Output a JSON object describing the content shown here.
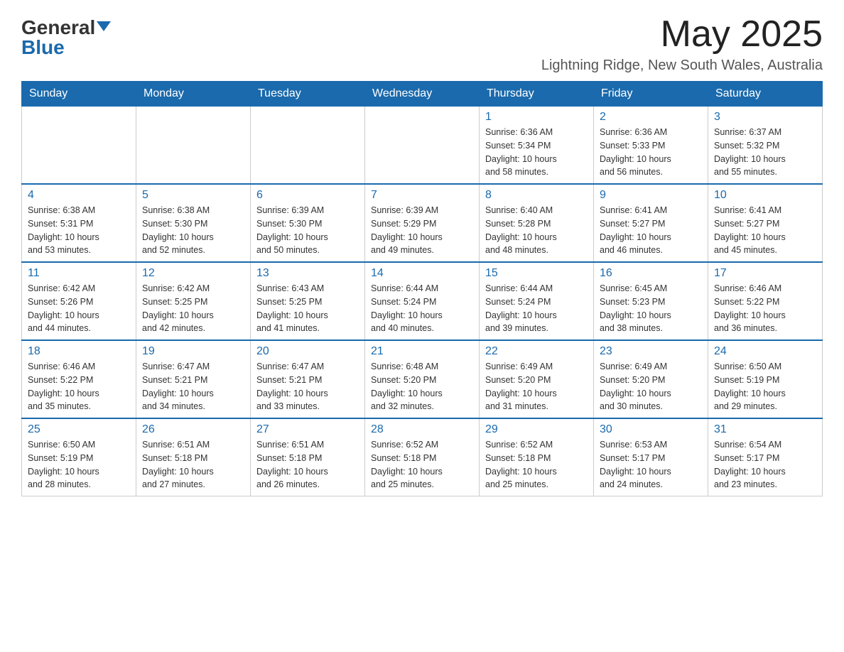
{
  "header": {
    "logo_general": "General",
    "logo_blue": "Blue",
    "month_year": "May 2025",
    "location": "Lightning Ridge, New South Wales, Australia"
  },
  "days_of_week": [
    "Sunday",
    "Monday",
    "Tuesday",
    "Wednesday",
    "Thursday",
    "Friday",
    "Saturday"
  ],
  "weeks": [
    [
      {
        "day": "",
        "info": ""
      },
      {
        "day": "",
        "info": ""
      },
      {
        "day": "",
        "info": ""
      },
      {
        "day": "",
        "info": ""
      },
      {
        "day": "1",
        "info": "Sunrise: 6:36 AM\nSunset: 5:34 PM\nDaylight: 10 hours\nand 58 minutes."
      },
      {
        "day": "2",
        "info": "Sunrise: 6:36 AM\nSunset: 5:33 PM\nDaylight: 10 hours\nand 56 minutes."
      },
      {
        "day": "3",
        "info": "Sunrise: 6:37 AM\nSunset: 5:32 PM\nDaylight: 10 hours\nand 55 minutes."
      }
    ],
    [
      {
        "day": "4",
        "info": "Sunrise: 6:38 AM\nSunset: 5:31 PM\nDaylight: 10 hours\nand 53 minutes."
      },
      {
        "day": "5",
        "info": "Sunrise: 6:38 AM\nSunset: 5:30 PM\nDaylight: 10 hours\nand 52 minutes."
      },
      {
        "day": "6",
        "info": "Sunrise: 6:39 AM\nSunset: 5:30 PM\nDaylight: 10 hours\nand 50 minutes."
      },
      {
        "day": "7",
        "info": "Sunrise: 6:39 AM\nSunset: 5:29 PM\nDaylight: 10 hours\nand 49 minutes."
      },
      {
        "day": "8",
        "info": "Sunrise: 6:40 AM\nSunset: 5:28 PM\nDaylight: 10 hours\nand 48 minutes."
      },
      {
        "day": "9",
        "info": "Sunrise: 6:41 AM\nSunset: 5:27 PM\nDaylight: 10 hours\nand 46 minutes."
      },
      {
        "day": "10",
        "info": "Sunrise: 6:41 AM\nSunset: 5:27 PM\nDaylight: 10 hours\nand 45 minutes."
      }
    ],
    [
      {
        "day": "11",
        "info": "Sunrise: 6:42 AM\nSunset: 5:26 PM\nDaylight: 10 hours\nand 44 minutes."
      },
      {
        "day": "12",
        "info": "Sunrise: 6:42 AM\nSunset: 5:25 PM\nDaylight: 10 hours\nand 42 minutes."
      },
      {
        "day": "13",
        "info": "Sunrise: 6:43 AM\nSunset: 5:25 PM\nDaylight: 10 hours\nand 41 minutes."
      },
      {
        "day": "14",
        "info": "Sunrise: 6:44 AM\nSunset: 5:24 PM\nDaylight: 10 hours\nand 40 minutes."
      },
      {
        "day": "15",
        "info": "Sunrise: 6:44 AM\nSunset: 5:24 PM\nDaylight: 10 hours\nand 39 minutes."
      },
      {
        "day": "16",
        "info": "Sunrise: 6:45 AM\nSunset: 5:23 PM\nDaylight: 10 hours\nand 38 minutes."
      },
      {
        "day": "17",
        "info": "Sunrise: 6:46 AM\nSunset: 5:22 PM\nDaylight: 10 hours\nand 36 minutes."
      }
    ],
    [
      {
        "day": "18",
        "info": "Sunrise: 6:46 AM\nSunset: 5:22 PM\nDaylight: 10 hours\nand 35 minutes."
      },
      {
        "day": "19",
        "info": "Sunrise: 6:47 AM\nSunset: 5:21 PM\nDaylight: 10 hours\nand 34 minutes."
      },
      {
        "day": "20",
        "info": "Sunrise: 6:47 AM\nSunset: 5:21 PM\nDaylight: 10 hours\nand 33 minutes."
      },
      {
        "day": "21",
        "info": "Sunrise: 6:48 AM\nSunset: 5:20 PM\nDaylight: 10 hours\nand 32 minutes."
      },
      {
        "day": "22",
        "info": "Sunrise: 6:49 AM\nSunset: 5:20 PM\nDaylight: 10 hours\nand 31 minutes."
      },
      {
        "day": "23",
        "info": "Sunrise: 6:49 AM\nSunset: 5:20 PM\nDaylight: 10 hours\nand 30 minutes."
      },
      {
        "day": "24",
        "info": "Sunrise: 6:50 AM\nSunset: 5:19 PM\nDaylight: 10 hours\nand 29 minutes."
      }
    ],
    [
      {
        "day": "25",
        "info": "Sunrise: 6:50 AM\nSunset: 5:19 PM\nDaylight: 10 hours\nand 28 minutes."
      },
      {
        "day": "26",
        "info": "Sunrise: 6:51 AM\nSunset: 5:18 PM\nDaylight: 10 hours\nand 27 minutes."
      },
      {
        "day": "27",
        "info": "Sunrise: 6:51 AM\nSunset: 5:18 PM\nDaylight: 10 hours\nand 26 minutes."
      },
      {
        "day": "28",
        "info": "Sunrise: 6:52 AM\nSunset: 5:18 PM\nDaylight: 10 hours\nand 25 minutes."
      },
      {
        "day": "29",
        "info": "Sunrise: 6:52 AM\nSunset: 5:18 PM\nDaylight: 10 hours\nand 25 minutes."
      },
      {
        "day": "30",
        "info": "Sunrise: 6:53 AM\nSunset: 5:17 PM\nDaylight: 10 hours\nand 24 minutes."
      },
      {
        "day": "31",
        "info": "Sunrise: 6:54 AM\nSunset: 5:17 PM\nDaylight: 10 hours\nand 23 minutes."
      }
    ]
  ]
}
